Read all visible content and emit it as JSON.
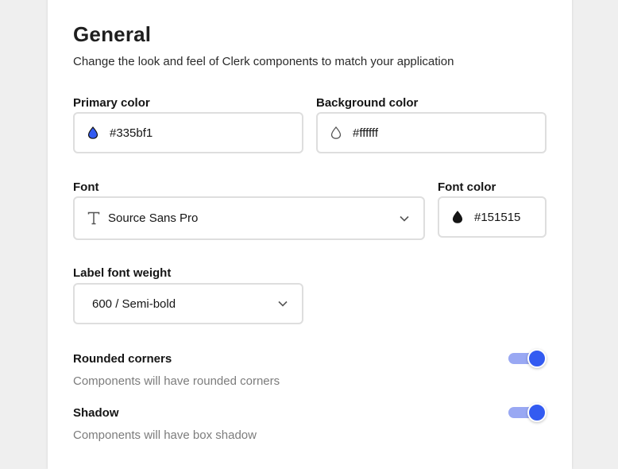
{
  "section": {
    "title": "General",
    "subtitle": "Change the look and feel of Clerk components to match your application"
  },
  "primary_color": {
    "label": "Primary color",
    "value": "#335bf1",
    "swatch": "#335bf1"
  },
  "background_color": {
    "label": "Background color",
    "value": "#ffffff",
    "swatch": "#ffffff"
  },
  "font": {
    "label": "Font",
    "value": "Source Sans Pro",
    "icon": "text-T-icon"
  },
  "font_color": {
    "label": "Font color",
    "value": "#151515",
    "swatch": "#151515"
  },
  "label_font_weight": {
    "label": "Label font weight",
    "value": "600 / Semi-bold"
  },
  "rounded_corners": {
    "title": "Rounded corners",
    "description": "Components will have rounded corners",
    "enabled": true
  },
  "shadow": {
    "title": "Shadow",
    "description": "Components will have box shadow",
    "enabled": true
  },
  "colors": {
    "accent": "#335bf1",
    "toggle_track": "#99a8f3",
    "border": "#dedede",
    "muted_text": "#7c7c7c"
  }
}
